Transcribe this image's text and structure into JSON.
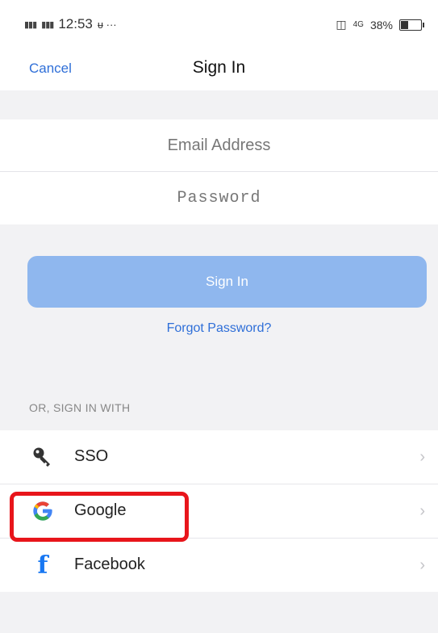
{
  "status_bar": {
    "signal_1": "4G",
    "signal_2": "4G",
    "time": "12:53",
    "extra": "ᵾ ···",
    "net": "4G",
    "battery_percent": "38%",
    "battery_level": 0.38
  },
  "nav": {
    "cancel_label": "Cancel",
    "title": "Sign In"
  },
  "form": {
    "email_placeholder": "Email Address",
    "email_value": "",
    "password_placeholder": "Password",
    "password_value": ""
  },
  "signin_button_label": "Sign In",
  "forgot_password_label": "Forgot Password?",
  "alt_signin": {
    "header": "OR, SIGN IN WITH",
    "items": [
      {
        "label": "SSO",
        "icon": "key-icon"
      },
      {
        "label": "Google",
        "icon": "google-icon"
      },
      {
        "label": "Facebook",
        "icon": "facebook-icon"
      }
    ]
  },
  "colors": {
    "accent": "#2f6fd8",
    "button_bg": "#8fb7ee",
    "highlight": "#e8151b"
  }
}
